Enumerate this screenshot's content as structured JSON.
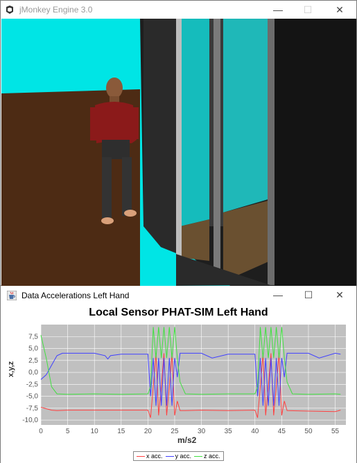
{
  "main_window": {
    "title": "jMonkey Engine 3.0",
    "controls": {
      "minimize": "—",
      "maximize": "☐",
      "close": "✕"
    }
  },
  "chart_window": {
    "title": "Data Accelerations Left Hand",
    "controls": {
      "minimize": "—",
      "maximize": "☐",
      "close": "✕"
    }
  },
  "chart_data": {
    "type": "line",
    "title": "Local Sensor PHAT-SIM Left Hand",
    "xlabel": "m/s2",
    "ylabel": "x,y,z",
    "xlim": [
      0,
      57
    ],
    "ylim": [
      -11,
      10
    ],
    "x_ticks": [
      0,
      5,
      10,
      15,
      20,
      25,
      30,
      35,
      40,
      45,
      50,
      55
    ],
    "x_tick_labels": [
      "0",
      "5",
      "10",
      "15",
      "20",
      "25",
      "30",
      "35",
      "40",
      "45",
      "50",
      "55"
    ],
    "y_ticks": [
      7.5,
      5.0,
      2.5,
      0.0,
      -2.5,
      -5.0,
      -7.5,
      -10.0
    ],
    "y_tick_labels": [
      "7,5",
      "5,0",
      "2,5",
      "0,0",
      "-2,5",
      "-5,0",
      "-7,5",
      "-10,0"
    ],
    "grid": true,
    "legend": "bottom",
    "series": [
      {
        "name": "x acc.",
        "color": "#ff4040",
        "x": [
          0,
          2,
          3,
          5,
          10,
          15,
          20,
          20.5,
          21,
          21.5,
          22,
          22.5,
          23,
          23.5,
          24,
          24.5,
          25,
          25.5,
          26,
          27,
          30,
          35,
          40,
          40.5,
          41,
          41.5,
          42,
          42.5,
          43,
          43.5,
          44,
          44.5,
          45,
          45.5,
          46,
          50,
          55,
          56
        ],
        "y": [
          -7.3,
          -7.9,
          -8.0,
          -7.9,
          -7.9,
          -7.9,
          -7.9,
          -9.5,
          -3,
          4,
          -9,
          -3,
          4,
          -9,
          -3,
          4,
          -9,
          -6,
          -8,
          -8,
          -7.9,
          -8.0,
          -7.9,
          -9.5,
          -3,
          4,
          -9,
          -3,
          4,
          -9,
          -3,
          4,
          -9,
          -6,
          -8,
          -8.1,
          -8.2,
          -7.9
        ]
      },
      {
        "name": "y acc.",
        "color": "#4040ff",
        "x": [
          0,
          1,
          2,
          3,
          4,
          5,
          10,
          12,
          12.5,
          13,
          15,
          20,
          20.5,
          21,
          21.5,
          22,
          22.5,
          23,
          23.5,
          24,
          24.5,
          25,
          25.5,
          26,
          30,
          32,
          35,
          40,
          40.5,
          41,
          41.5,
          42,
          42.5,
          43,
          43.5,
          44,
          44.5,
          45,
          45.5,
          46,
          50,
          52,
          55,
          56
        ],
        "y": [
          -1.5,
          -0.5,
          1.5,
          3.5,
          4.0,
          4.0,
          4.0,
          3.5,
          2.8,
          3.5,
          3.8,
          3.8,
          -5,
          3,
          -7,
          3,
          -7,
          3,
          -7,
          3,
          -7,
          3,
          -1,
          4,
          4,
          3,
          3.8,
          3.8,
          -5,
          3,
          -7,
          3,
          -7,
          3,
          -7,
          3,
          -7,
          3,
          -1,
          4,
          4,
          3,
          4,
          3.8
        ]
      },
      {
        "name": "z acc.",
        "color": "#40e040",
        "x": [
          0,
          1,
          2,
          3,
          5,
          10,
          15,
          20,
          20.5,
          21,
          21.5,
          22,
          22.5,
          23,
          23.5,
          24,
          24.5,
          25,
          25.5,
          26,
          27,
          30,
          35,
          40,
          40.5,
          41,
          41.5,
          42,
          42.5,
          43,
          43.5,
          44,
          44.5,
          45,
          45.5,
          46,
          47,
          50,
          55,
          56
        ],
        "y": [
          7.8,
          3,
          -3,
          -4.5,
          -4.6,
          -4.5,
          -4.6,
          -4.5,
          -3,
          9.5,
          3,
          9.5,
          3,
          9.5,
          3,
          9.5,
          3,
          9.5,
          3,
          -2,
          -4.5,
          -4.6,
          -4.5,
          -4.5,
          -3,
          9.5,
          3,
          9.5,
          3,
          9.5,
          3,
          9.5,
          3,
          9.5,
          3,
          -2,
          -4.5,
          -4.6,
          -4.5,
          -4.6
        ]
      }
    ]
  }
}
